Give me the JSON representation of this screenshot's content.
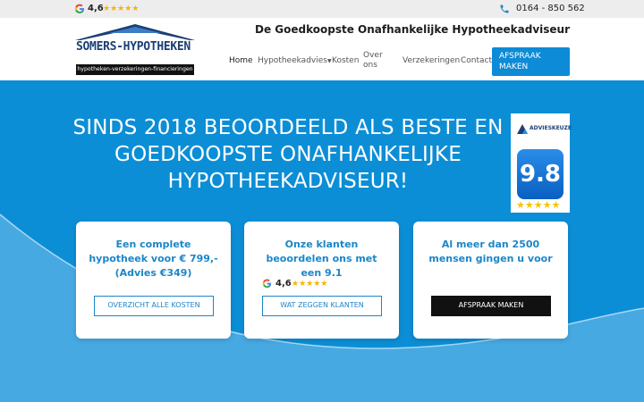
{
  "topbar": {
    "google_rating": "4,6",
    "rating_stars": 5,
    "phone": "0164 - 850 562",
    "icons": [
      "google-icon",
      "phone-icon"
    ]
  },
  "header": {
    "logo_name": "SOMERS-HYPOTHEKEN",
    "logo_tagline": "hypotheken-verzekeringen-financieringen",
    "tagline": "De Goedkoopste Onafhankelijke Hypotheekadviseur",
    "nav": {
      "home": "Home",
      "hypotheekadvies": "Hypotheekadvies",
      "kosten": "Kosten",
      "over_ons_1": "Over",
      "over_ons_2": "ons",
      "verzekeringen": "Verzekeringen",
      "contact": "Contact"
    },
    "cta_line1": "AFSPRAAK",
    "cta_line2": "MAKEN"
  },
  "hero": {
    "title_line1": "SINDS 2018 BEOORDEELD ALS BESTE EN",
    "title_line2": "GOEDKOOPSTE ONAFHANKELIJKE",
    "title_line3": "HYPOTHEEKADVISEUR!",
    "badge": {
      "brand": "ADVIESKEUZE",
      "score": "9.8",
      "stars": 5
    }
  },
  "cards": [
    {
      "line1": "Een complete",
      "line2": "hypotheek voor € 799,-",
      "line3": "(Advies €349)",
      "button": "OVERZICHT ALLE  KOSTEN"
    },
    {
      "line1": "Onze klanten",
      "line2": "beoordelen ons met",
      "line3": "een 9.1",
      "rating": "4,6",
      "button": "WAT ZEGGEN KLANTEN"
    },
    {
      "line1": "Al meer dan 2500",
      "line2": "mensen gingen u voor",
      "line3": "",
      "button": "AFSPRAAK MAKEN"
    }
  ],
  "colors": {
    "brand_blue": "#0c8ed6",
    "logo_navy": "#1b3f75",
    "card_text": "#1b86c8",
    "star": "#f6b400"
  }
}
